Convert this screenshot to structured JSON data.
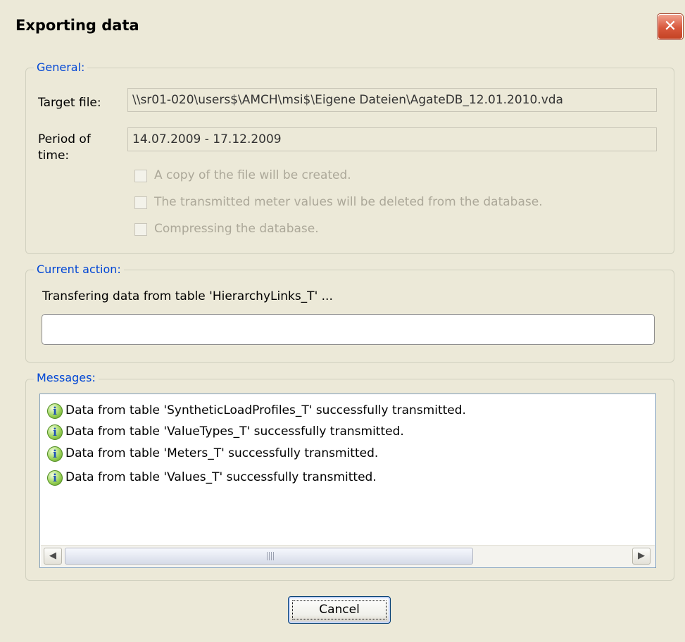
{
  "window": {
    "title": "Exporting data",
    "close_glyph": "✕"
  },
  "general": {
    "legend": "General:",
    "target_file_label": "Target file:",
    "target_file_value": "\\\\sr01-020\\users$\\AMCH\\msi$\\Eigene Dateien\\AgateDB_12.01.2010.vda",
    "period_label_line1": "Period of",
    "period_label_line2": "time:",
    "period_value": "14.07.2009 - 17.12.2009",
    "options": [
      {
        "label": "A copy of the file will be created.",
        "checked": false,
        "enabled": false
      },
      {
        "label": "The transmitted meter values will be deleted from the database.",
        "checked": false,
        "enabled": false
      },
      {
        "label": "Compressing the database.",
        "checked": false,
        "enabled": false
      }
    ]
  },
  "current_action": {
    "legend": "Current action:",
    "status_text": "Transfering data from table 'HierarchyLinks_T' ...",
    "progress": 0
  },
  "messages": {
    "legend": "Messages:",
    "icon": "info-icon",
    "icon_glyph": "i",
    "items": [
      "Data from table 'SyntheticLoadProfiles_T' successfully transmitted.",
      "Data from table 'ValueTypes_T' successfully transmitted.",
      "Data from table 'Meters_T' successfully transmitted.",
      "Data from table 'Values_T' successfully transmitted."
    ],
    "scroll_left_glyph": "◀",
    "scroll_right_glyph": "▶"
  },
  "buttons": {
    "cancel_label": "Cancel"
  },
  "colors": {
    "dialog_bg": "#ece9d8",
    "legend_text": "#0046d5",
    "close_button": "#d8583c",
    "info_icon": "#9cd35a"
  }
}
